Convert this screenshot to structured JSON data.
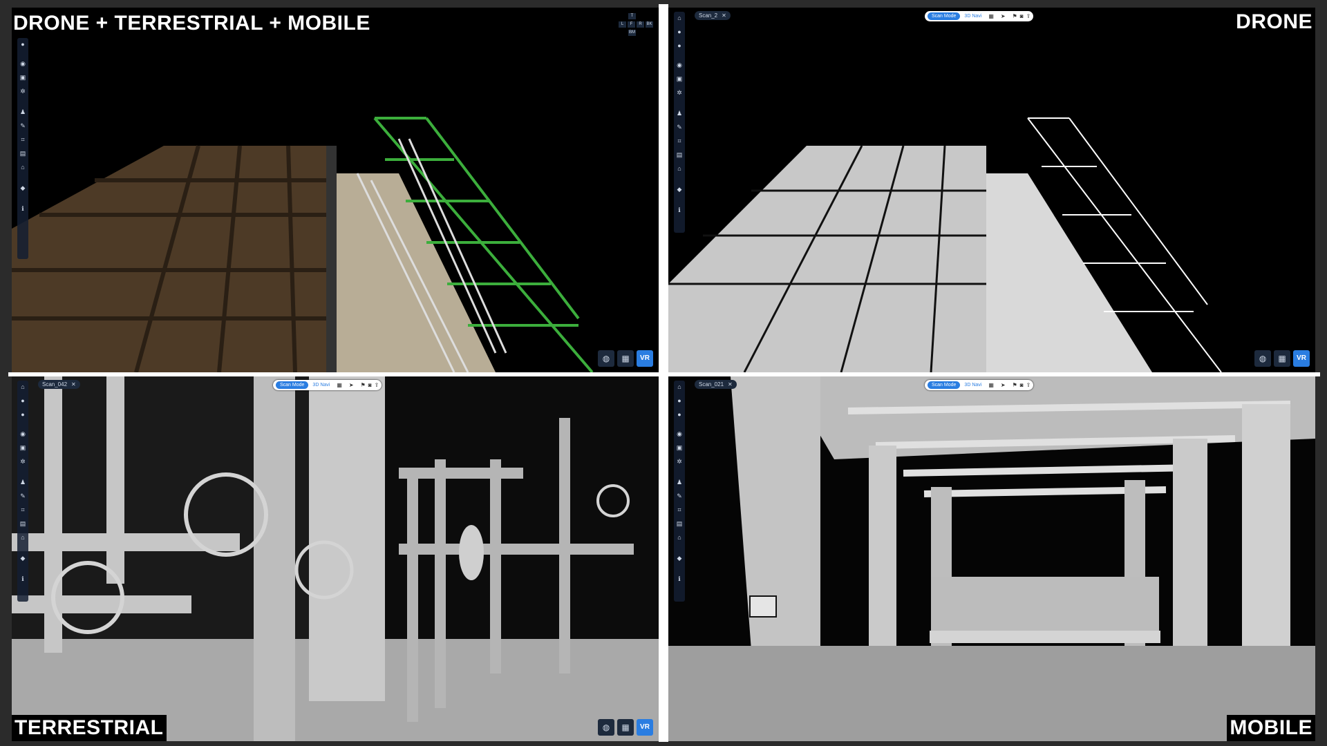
{
  "panels": {
    "tl": {
      "label": "DRONE + TERRESTRIAL + MOBILE",
      "toolbar_icons": [
        "circle-icon",
        "target-icon",
        "camera-icon",
        "gear-icon",
        "person-icon",
        "pen-icon",
        "crop-icon",
        "save-icon",
        "dome-icon",
        "tag-icon",
        "info-icon"
      ],
      "viewcube": {
        "cells": [
          "T",
          "L",
          "F",
          "R",
          "BK",
          "BM"
        ]
      },
      "bottom_buttons": [
        "globe-icon",
        "layers-icon",
        "vr-icon"
      ],
      "vr_label": "VR"
    },
    "tr": {
      "label": "DRONE",
      "scan_tab": "Scan_2",
      "topbar": {
        "mode": "Scan Mode",
        "navi": "3D Navi"
      },
      "toolbar_icons": [
        "home-icon",
        "circle-icon",
        "circle-icon",
        "target-icon",
        "camera-icon",
        "gear-icon",
        "person-icon",
        "pen-icon",
        "crop-icon",
        "save-icon",
        "dome-icon",
        "tag-icon",
        "info-icon"
      ],
      "bottom_buttons": [
        "globe-icon",
        "layers-icon",
        "vr-icon"
      ],
      "vr_label": "VR"
    },
    "bl": {
      "label": "TERRESTRIAL",
      "scan_tab": "Scan_042",
      "topbar": {
        "mode": "Scan Mode",
        "navi": "3D Navi"
      },
      "bottom_buttons": [
        "globe-icon",
        "layers-icon",
        "vr-icon"
      ],
      "vr_label": "VR"
    },
    "br": {
      "label": "MOBILE",
      "scan_tab": "Scan_021",
      "topbar": {
        "mode": "Scan Mode",
        "navi": "3D Navi"
      }
    }
  },
  "colors": {
    "accent": "#2a7de1",
    "toolbar": "#1d2a3d",
    "background": "#000000",
    "frame": "#2b2b2b"
  }
}
